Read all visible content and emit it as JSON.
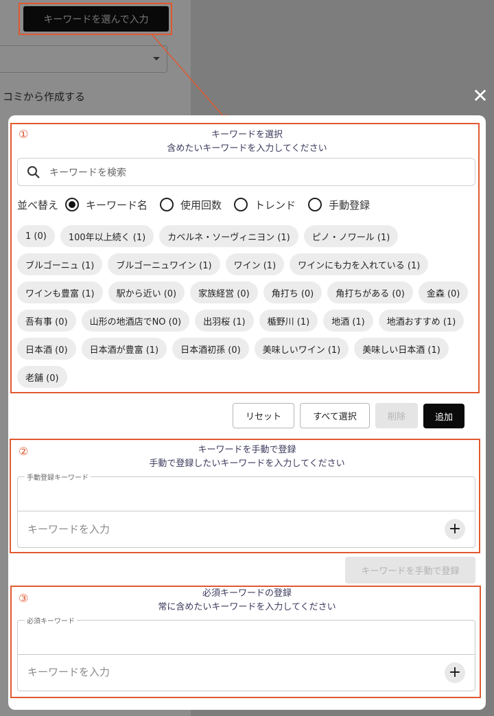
{
  "background": {
    "top_button_label": "キーワードを選んで入力",
    "kuchikomi_text": "コミから作成する"
  },
  "modal": {
    "close_icon": "close-icon",
    "section1": {
      "number": "①",
      "title": "キーワードを選択",
      "subtitle": "含めたいキーワードを入力してください",
      "search_placeholder": "キーワードを検索",
      "sort_label": "並べ替え",
      "sort_options": [
        {
          "label": "キーワード名",
          "selected": true
        },
        {
          "label": "使用回数",
          "selected": false
        },
        {
          "label": "トレンド",
          "selected": false
        },
        {
          "label": "手動登録",
          "selected": false
        }
      ],
      "keywords": [
        "1 (0)",
        "100年以上続く (1)",
        "カベルネ・ソーヴィニヨン (1)",
        "ピノ・ノワール (1)",
        "ブルゴーニュ (1)",
        "ブルゴーニュワイン (1)",
        "ワイン (1)",
        "ワインにも力を入れている (1)",
        "ワインも豊富 (1)",
        "駅から近い (0)",
        "家族経営 (0)",
        "角打ち (0)",
        "角打ちがある (0)",
        "金森 (0)",
        "吾有事 (0)",
        "山形の地酒店でNO (0)",
        "出羽桜 (1)",
        "楯野川 (1)",
        "地酒 (1)",
        "地酒おすすめ (1)",
        "日本酒 (0)",
        "日本酒が豊富 (1)",
        "日本酒初孫 (0)",
        "美味しいワイン (1)",
        "美味しい日本酒 (1)",
        "老舗 (0)"
      ]
    },
    "actions": {
      "reset": "リセット",
      "select_all": "すべて選択",
      "delete": "削除",
      "add": "追加"
    },
    "section2": {
      "number": "②",
      "title": "キーワードを手動で登録",
      "subtitle": "手動で登録したいキーワードを入力してください",
      "field_legend": "手動登録キーワード",
      "input_placeholder": "キーワードを入力",
      "register_button": "キーワードを手動で登録"
    },
    "section3": {
      "number": "③",
      "title": "必須キーワードの登録",
      "subtitle": "常に含めたいキーワードを入力してください",
      "field_legend": "必須キーワード",
      "input_placeholder": "キーワードを入力"
    }
  },
  "colors": {
    "annotation": "#e0582f",
    "overlay": "rgba(0,0,0,0.45)",
    "chip_bg": "#ececec",
    "primary_button": "#0a0a0a"
  }
}
